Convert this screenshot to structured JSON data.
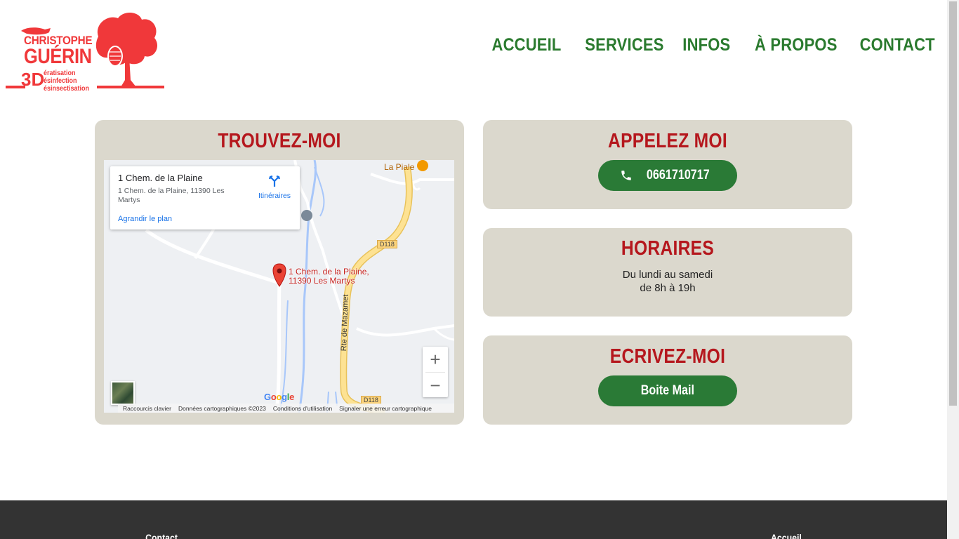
{
  "logo": {
    "name_line1": "CHRISTOPHE",
    "name_line2": "GUÉRIN",
    "brand_3d": "3D",
    "services": [
      "ératisation",
      "ésinfection",
      "ésinsectisation"
    ],
    "color": "#f0383a"
  },
  "nav": {
    "items": [
      "ACCUEIL",
      "SERVICES",
      "INFOS",
      "À PROPOS",
      "CONTACT"
    ],
    "color": "#2a7a2e"
  },
  "find": {
    "title": "TROUVEZ-MOI",
    "map": {
      "info_title": "1 Chem. de la Plaine",
      "info_address": "1 Chem. de la Plaine, 11390 Les Martys",
      "directions_label": "Itinéraires",
      "enlarge_label": "Agrandir le plan",
      "pin_label_line1": "1 Chem. de la Plaine,",
      "pin_label_line2": "11390 Les Martys",
      "poi_label": "La Piale",
      "road_labels": [
        "D118",
        "Rte de Mazamet",
        "D118"
      ],
      "zoom_in": "+",
      "zoom_out": "−",
      "google": "Google",
      "attribution": [
        "Raccourcis clavier",
        "Données cartographiques ©2023",
        "Conditions d'utilisation",
        "Signaler une erreur cartographique"
      ]
    }
  },
  "call": {
    "title": "APPELEZ  MOI",
    "phone": "0661710717"
  },
  "hours": {
    "title": "HORAIRES",
    "line1": "Du lundi au samedi",
    "line2": "de 8h à 19h"
  },
  "write": {
    "title": "ECRIVEZ-MOI",
    "button": "Boite Mail"
  },
  "footer": {
    "left_heading": "Contact",
    "right_heading": "Accueil"
  },
  "colors": {
    "card_bg": "#dbd8cd",
    "title_red": "#b5171d",
    "button_green": "#2a7a36",
    "footer_bg": "#333333"
  }
}
